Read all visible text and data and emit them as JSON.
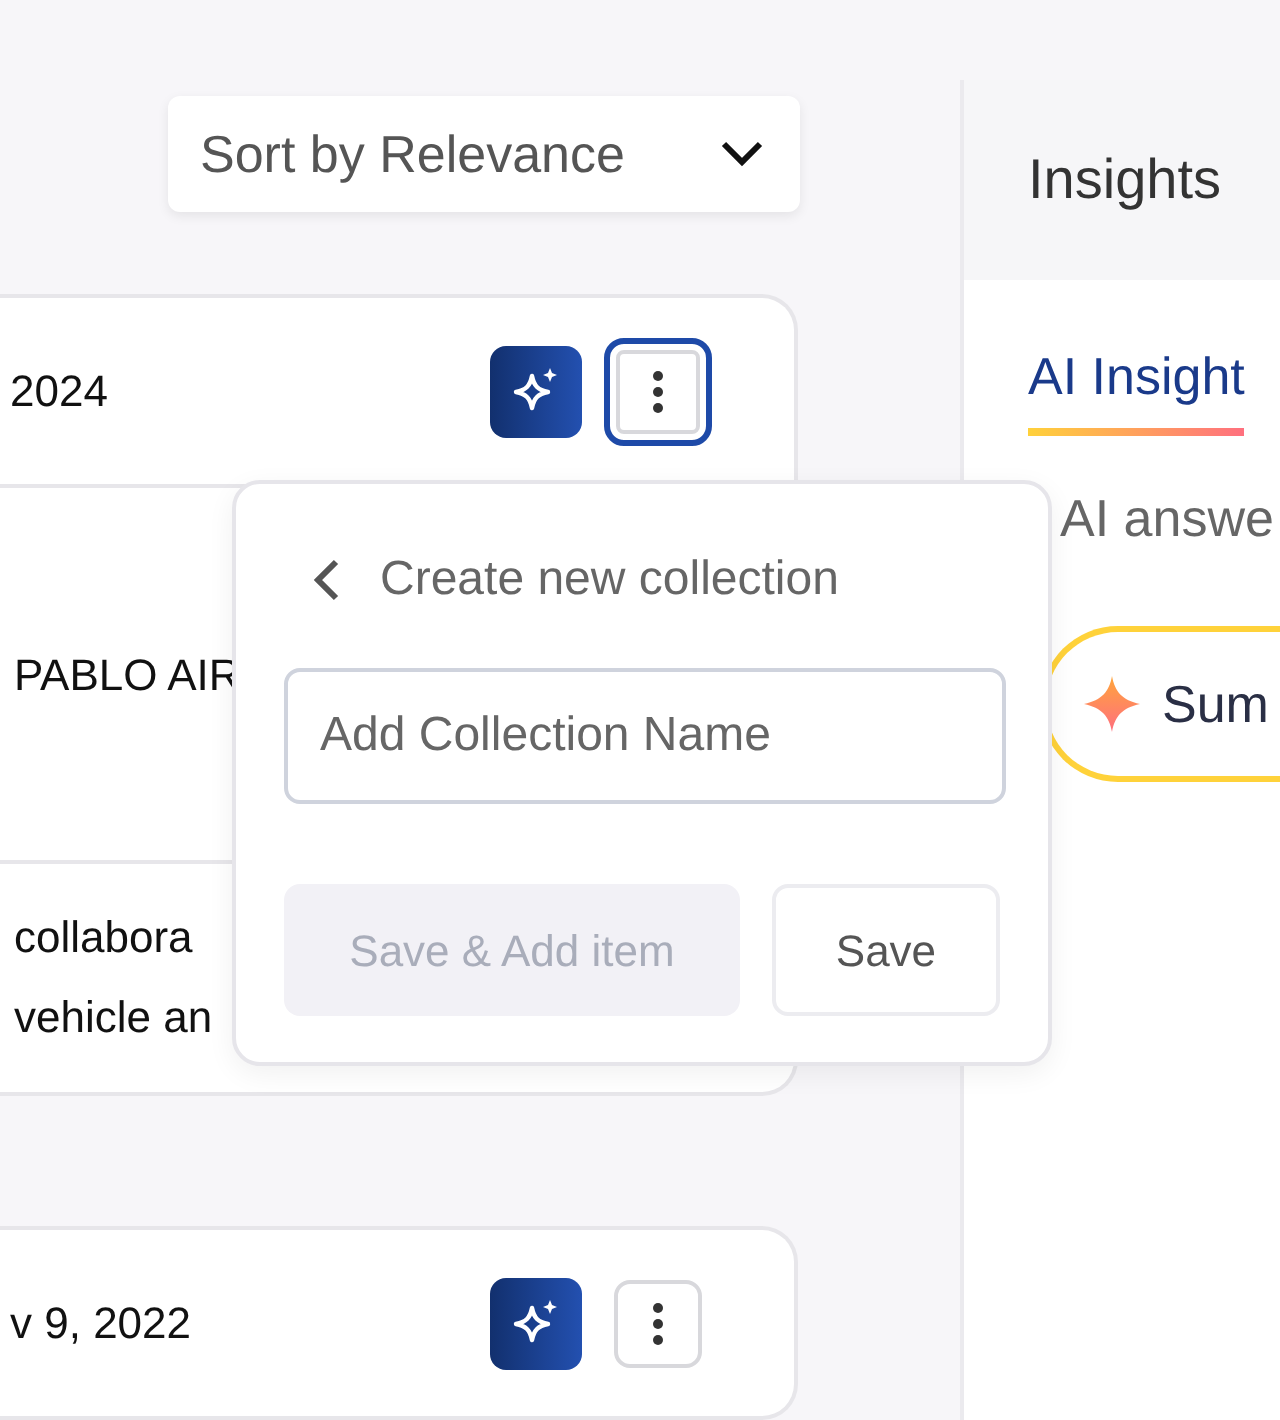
{
  "sort": {
    "label": "Sort by Relevance"
  },
  "results": [
    {
      "date": "2024",
      "menu_focused": true,
      "sections": [
        {
          "kind": "title",
          "lines": [
            "PABLO AIR"
          ]
        },
        {
          "kind": "snippet",
          "lines": [
            "collabora",
            "vehicle an"
          ]
        }
      ]
    },
    {
      "date": "v 9, 2022",
      "menu_focused": false
    }
  ],
  "popup": {
    "title": "Create new collection",
    "placeholder": "Add Collection Name",
    "buttons": [
      {
        "label": "Save & Add item",
        "disabled": true
      },
      {
        "label": "Save",
        "disabled": false
      }
    ]
  },
  "insights": {
    "title": "Insights",
    "tabs": [
      {
        "label": "AI Insight",
        "selected": true
      }
    ],
    "subtitle": "AI answe",
    "chip": "Sum"
  }
}
